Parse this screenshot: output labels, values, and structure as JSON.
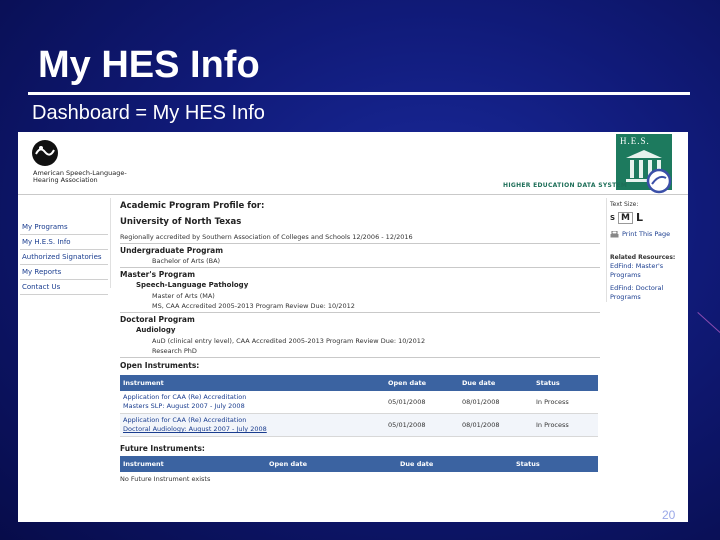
{
  "slide": {
    "title": "My HES Info",
    "subtitle": "Dashboard = My HES Info",
    "page_number": "20"
  },
  "header": {
    "asha_name": "American Speech-Language-Hearing Association",
    "hes_logo_text": "H.E.S.",
    "system_name": "HIGHER EDUCATION DATA SYSTEM"
  },
  "nav": {
    "items": [
      "My Programs",
      "My H.E.S. Info",
      "Authorized Signatories",
      "My Reports",
      "Contact Us"
    ]
  },
  "main": {
    "profile_heading": "Academic Program Profile for:",
    "university": "University of North Texas",
    "accreditation": "Regionally accredited by Southern Association of Colleges and Schools 12/2006 - 12/2016",
    "undergrad_title": "Undergraduate Program",
    "undergrad_degree": "Bachelor of Arts (BA)",
    "masters_title": "Master's Program",
    "masters_area": "Speech-Language Pathology",
    "masters_degree": "Master of Arts (MA)",
    "masters_detail": "MS, CAA Accredited 2005-2013 Program Review Due: 10/2012",
    "doctoral_title": "Doctoral Program",
    "doctoral_area": "Audiology",
    "doctoral_detail": "AuD (clinical entry level), CAA Accredited 2005-2013 Program Review Due: 10/2012",
    "doctoral_research": "Research PhD",
    "open_title": "Open Instruments:",
    "open_headers": [
      "Instrument",
      "Open date",
      "Due date",
      "Status"
    ],
    "open_rows": [
      {
        "name": "Application for CAA (Re) Accreditation",
        "period": "Masters SLP: August 2007 - July 2008",
        "open": "05/01/2008",
        "due": "08/01/2008",
        "status": "In Process"
      },
      {
        "name": "Application for CAA (Re) Accreditation",
        "period": "Doctoral Audiology: August 2007 - July 2008",
        "open": "05/01/2008",
        "due": "08/01/2008",
        "status": "In Process"
      }
    ],
    "future_title": "Future Instruments:",
    "future_headers": [
      "Instrument",
      "Open date",
      "Due date",
      "Status"
    ],
    "future_empty": "No Future Instrument exists"
  },
  "right": {
    "text_size_label": "Text Size:",
    "sizes": [
      "S",
      "M",
      "L"
    ],
    "print_label": "Print This Page",
    "related_title": "Related Resources:",
    "links": [
      "EdFind: Master's Programs",
      "EdFind: Doctoral Programs"
    ]
  },
  "colors": {
    "slide_bg": "#101a78",
    "table_header": "#3b63a1",
    "hes_green": "#1d7a5e",
    "link": "#1a3d8f"
  }
}
